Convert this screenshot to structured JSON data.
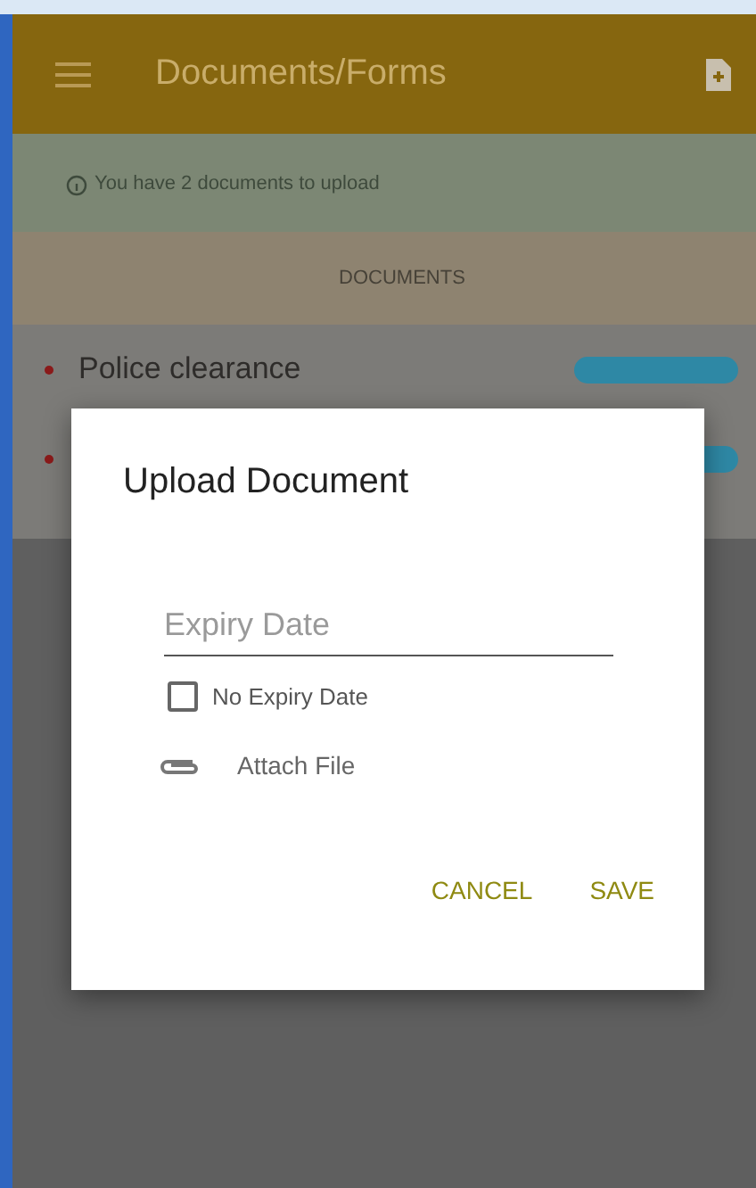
{
  "app_bar": {
    "title": "Documents/Forms"
  },
  "banner": {
    "text": "You have 2 documents to upload"
  },
  "section_header": "DOCUMENTS",
  "documents": [
    {
      "kind": "row",
      "name": "Police clearance"
    },
    {
      "kind": "row"
    }
  ],
  "dialog": {
    "title": "Upload Document",
    "expiry_field": {
      "placeholder": "Expiry Date"
    },
    "no_expiry": {
      "label": "No Expiry Date",
      "checked": false
    },
    "attach": {
      "label": "Attach File"
    },
    "buttons": [
      "CANCEL",
      "SAVE"
    ]
  }
}
